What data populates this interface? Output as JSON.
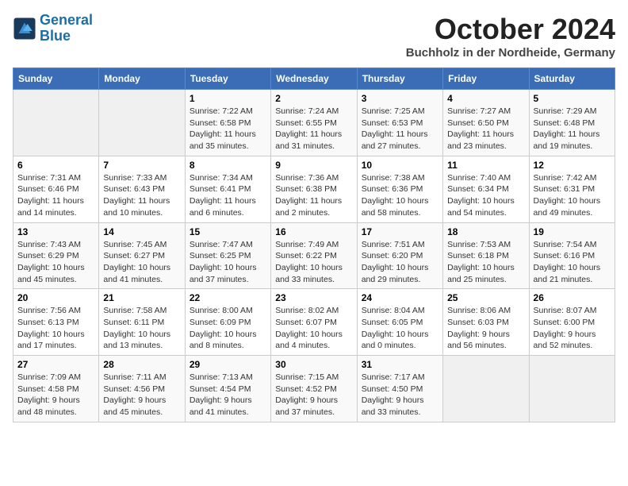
{
  "header": {
    "logo_line1": "General",
    "logo_line2": "Blue",
    "month": "October 2024",
    "location": "Buchholz in der Nordheide, Germany"
  },
  "weekdays": [
    "Sunday",
    "Monday",
    "Tuesday",
    "Wednesday",
    "Thursday",
    "Friday",
    "Saturday"
  ],
  "weeks": [
    [
      {
        "day": "",
        "detail": ""
      },
      {
        "day": "",
        "detail": ""
      },
      {
        "day": "1",
        "detail": "Sunrise: 7:22 AM\nSunset: 6:58 PM\nDaylight: 11 hours and 35 minutes."
      },
      {
        "day": "2",
        "detail": "Sunrise: 7:24 AM\nSunset: 6:55 PM\nDaylight: 11 hours and 31 minutes."
      },
      {
        "day": "3",
        "detail": "Sunrise: 7:25 AM\nSunset: 6:53 PM\nDaylight: 11 hours and 27 minutes."
      },
      {
        "day": "4",
        "detail": "Sunrise: 7:27 AM\nSunset: 6:50 PM\nDaylight: 11 hours and 23 minutes."
      },
      {
        "day": "5",
        "detail": "Sunrise: 7:29 AM\nSunset: 6:48 PM\nDaylight: 11 hours and 19 minutes."
      }
    ],
    [
      {
        "day": "6",
        "detail": "Sunrise: 7:31 AM\nSunset: 6:46 PM\nDaylight: 11 hours and 14 minutes."
      },
      {
        "day": "7",
        "detail": "Sunrise: 7:33 AM\nSunset: 6:43 PM\nDaylight: 11 hours and 10 minutes."
      },
      {
        "day": "8",
        "detail": "Sunrise: 7:34 AM\nSunset: 6:41 PM\nDaylight: 11 hours and 6 minutes."
      },
      {
        "day": "9",
        "detail": "Sunrise: 7:36 AM\nSunset: 6:38 PM\nDaylight: 11 hours and 2 minutes."
      },
      {
        "day": "10",
        "detail": "Sunrise: 7:38 AM\nSunset: 6:36 PM\nDaylight: 10 hours and 58 minutes."
      },
      {
        "day": "11",
        "detail": "Sunrise: 7:40 AM\nSunset: 6:34 PM\nDaylight: 10 hours and 54 minutes."
      },
      {
        "day": "12",
        "detail": "Sunrise: 7:42 AM\nSunset: 6:31 PM\nDaylight: 10 hours and 49 minutes."
      }
    ],
    [
      {
        "day": "13",
        "detail": "Sunrise: 7:43 AM\nSunset: 6:29 PM\nDaylight: 10 hours and 45 minutes."
      },
      {
        "day": "14",
        "detail": "Sunrise: 7:45 AM\nSunset: 6:27 PM\nDaylight: 10 hours and 41 minutes."
      },
      {
        "day": "15",
        "detail": "Sunrise: 7:47 AM\nSunset: 6:25 PM\nDaylight: 10 hours and 37 minutes."
      },
      {
        "day": "16",
        "detail": "Sunrise: 7:49 AM\nSunset: 6:22 PM\nDaylight: 10 hours and 33 minutes."
      },
      {
        "day": "17",
        "detail": "Sunrise: 7:51 AM\nSunset: 6:20 PM\nDaylight: 10 hours and 29 minutes."
      },
      {
        "day": "18",
        "detail": "Sunrise: 7:53 AM\nSunset: 6:18 PM\nDaylight: 10 hours and 25 minutes."
      },
      {
        "day": "19",
        "detail": "Sunrise: 7:54 AM\nSunset: 6:16 PM\nDaylight: 10 hours and 21 minutes."
      }
    ],
    [
      {
        "day": "20",
        "detail": "Sunrise: 7:56 AM\nSunset: 6:13 PM\nDaylight: 10 hours and 17 minutes."
      },
      {
        "day": "21",
        "detail": "Sunrise: 7:58 AM\nSunset: 6:11 PM\nDaylight: 10 hours and 13 minutes."
      },
      {
        "day": "22",
        "detail": "Sunrise: 8:00 AM\nSunset: 6:09 PM\nDaylight: 10 hours and 8 minutes."
      },
      {
        "day": "23",
        "detail": "Sunrise: 8:02 AM\nSunset: 6:07 PM\nDaylight: 10 hours and 4 minutes."
      },
      {
        "day": "24",
        "detail": "Sunrise: 8:04 AM\nSunset: 6:05 PM\nDaylight: 10 hours and 0 minutes."
      },
      {
        "day": "25",
        "detail": "Sunrise: 8:06 AM\nSunset: 6:03 PM\nDaylight: 9 hours and 56 minutes."
      },
      {
        "day": "26",
        "detail": "Sunrise: 8:07 AM\nSunset: 6:00 PM\nDaylight: 9 hours and 52 minutes."
      }
    ],
    [
      {
        "day": "27",
        "detail": "Sunrise: 7:09 AM\nSunset: 4:58 PM\nDaylight: 9 hours and 48 minutes."
      },
      {
        "day": "28",
        "detail": "Sunrise: 7:11 AM\nSunset: 4:56 PM\nDaylight: 9 hours and 45 minutes."
      },
      {
        "day": "29",
        "detail": "Sunrise: 7:13 AM\nSunset: 4:54 PM\nDaylight: 9 hours and 41 minutes."
      },
      {
        "day": "30",
        "detail": "Sunrise: 7:15 AM\nSunset: 4:52 PM\nDaylight: 9 hours and 37 minutes."
      },
      {
        "day": "31",
        "detail": "Sunrise: 7:17 AM\nSunset: 4:50 PM\nDaylight: 9 hours and 33 minutes."
      },
      {
        "day": "",
        "detail": ""
      },
      {
        "day": "",
        "detail": ""
      }
    ]
  ]
}
